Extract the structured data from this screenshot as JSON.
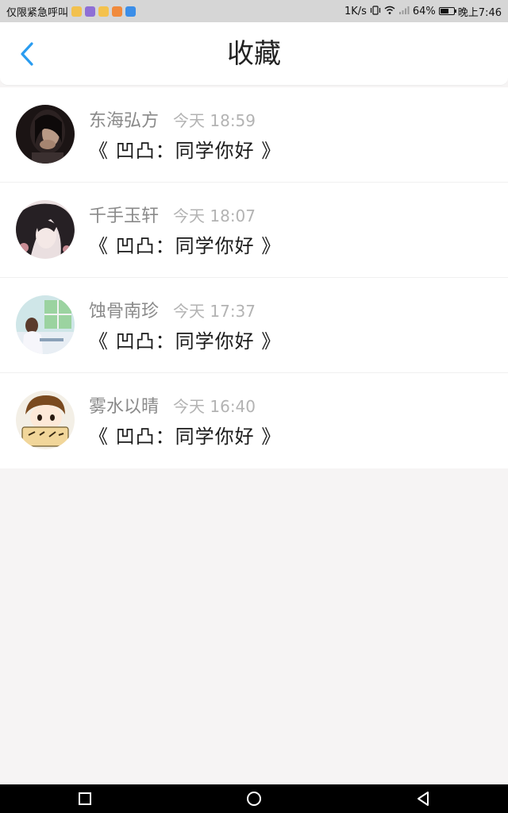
{
  "status_bar": {
    "carrier": "仅限紧急呼叫",
    "net_speed": "1K/s",
    "battery": "64%",
    "battery_level": 0.64,
    "time": "晚上7:46",
    "notification_icons": [
      {
        "name": "chat-notification-icon",
        "color": "#f2c14e"
      },
      {
        "name": "app-notification-icon",
        "color": "#8e6fd6"
      },
      {
        "name": "mail-notification-icon",
        "color": "#f4c24d"
      },
      {
        "name": "video-notification-icon",
        "color": "#f08a3c"
      },
      {
        "name": "browser-notification-icon",
        "color": "#3b8ee8"
      }
    ]
  },
  "header": {
    "title": "收藏",
    "back_icon": "chevron-left-icon",
    "accent_color": "#2a9cf0"
  },
  "favorites": [
    {
      "name": "东海弘方",
      "time": "今天 18:59",
      "title": "《 凹凸：同学你好 》",
      "avatar": "dark-portrait-avatar"
    },
    {
      "name": "千手玉轩",
      "time": "今天 18:07",
      "title": "《 凹凸：同学你好 》",
      "avatar": "sketch-portrait-avatar"
    },
    {
      "name": "蚀骨南珍",
      "time": "今天 17:37",
      "title": "《 凹凸：同学你好 》",
      "avatar": "window-scene-avatar"
    },
    {
      "name": "雾水以晴",
      "time": "今天 16:40",
      "title": "《 凹凸：同学你好 》",
      "avatar": "cartoon-boy-avatar"
    }
  ],
  "nav_bar": {
    "recent_icon": "square-recent-apps-icon",
    "home_icon": "circle-home-icon",
    "back_icon": "triangle-back-icon"
  }
}
